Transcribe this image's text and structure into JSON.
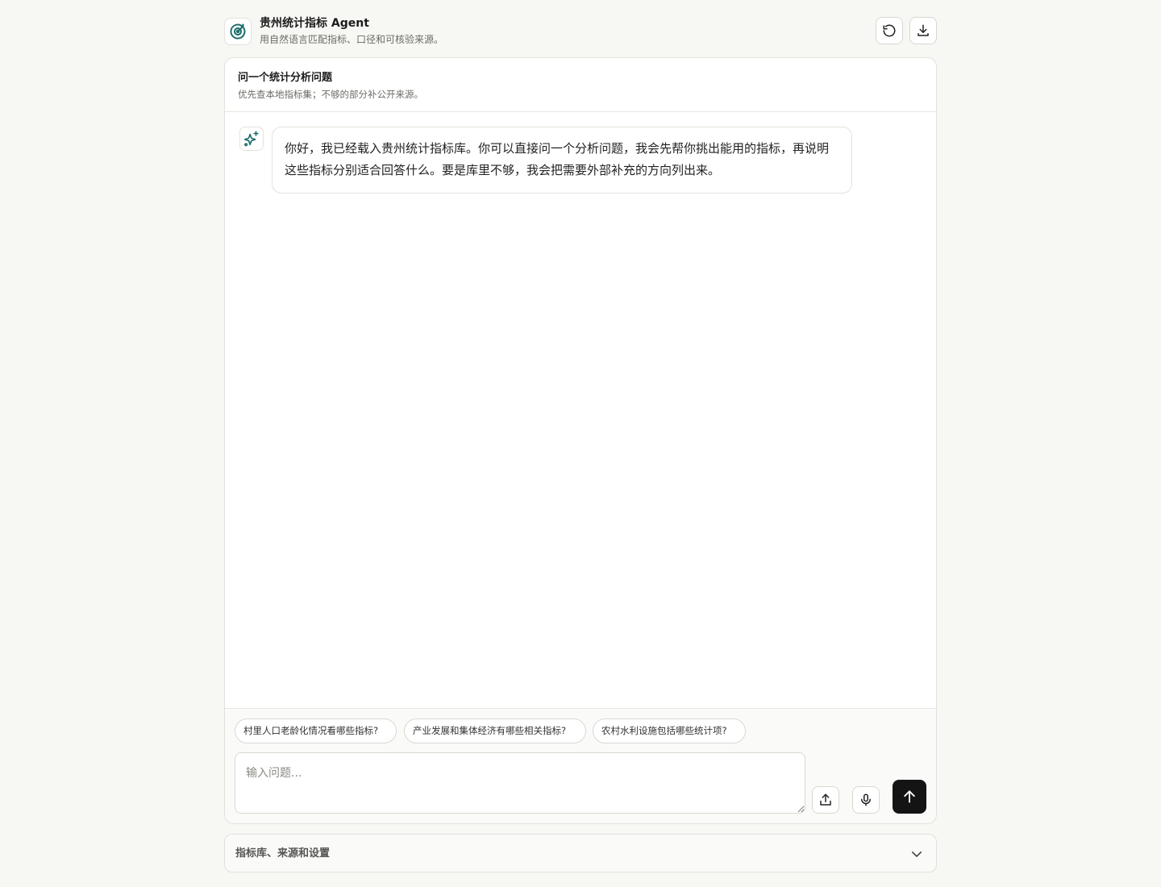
{
  "header": {
    "title": "贵州统计指标 Agent",
    "subtitle": "用自然语言匹配指标、口径和可核验来源。"
  },
  "panel": {
    "title": "问一个统计分析问题",
    "subtitle": "优先查本地指标集；不够的部分补公开来源。"
  },
  "messages": [
    {
      "role": "assistant",
      "text": "你好，我已经载入贵州统计指标库。你可以直接问一个分析问题，我会先帮你挑出能用的指标，再说明这些指标分别适合回答什么。要是库里不够，我会把需要外部补充的方向列出来。"
    }
  ],
  "suggestions": [
    "村里人口老龄化情况看哪些指标?",
    "产业发展和集体经济有哪些相关指标?",
    "农村水利设施包括哪些统计项?"
  ],
  "composer": {
    "placeholder": "输入问题..."
  },
  "footer": {
    "label": "指标库、来源和设置"
  },
  "colors": {
    "accent": "#1d6f6a",
    "send_button": "#141414",
    "background": "#f7f7f4"
  },
  "icons": {
    "logo": "target-radar-icon",
    "reset": "refresh-icon",
    "download": "download-icon",
    "assistant": "sparkles-icon",
    "upload": "upload-icon",
    "mic": "microphone-icon",
    "send": "arrow-up-icon",
    "footer": "chevron-down-icon"
  }
}
